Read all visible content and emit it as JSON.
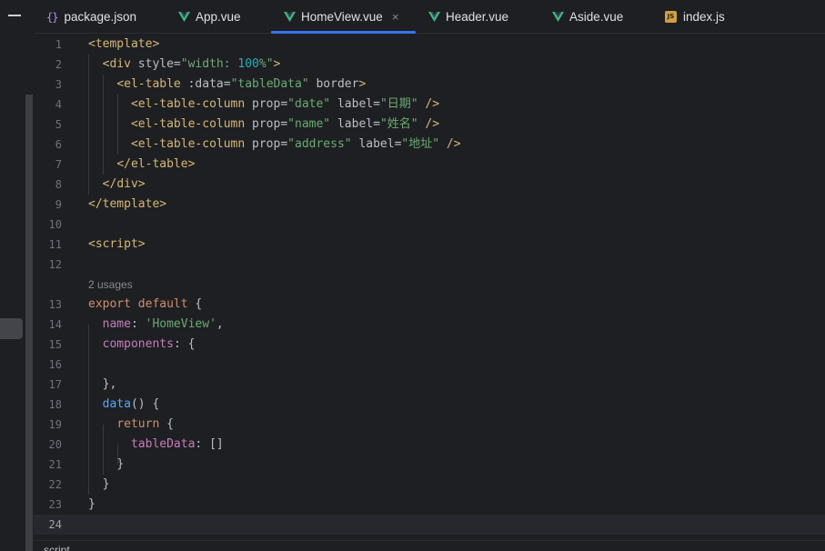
{
  "tabs": [
    {
      "label": "package.json",
      "icon": "json-braces-icon",
      "active": false
    },
    {
      "label": "App.vue",
      "icon": "vue-icon",
      "active": false
    },
    {
      "label": "HomeView.vue",
      "icon": "vue-icon",
      "active": true
    },
    {
      "label": "Header.vue",
      "icon": "vue-icon",
      "active": false
    },
    {
      "label": "Aside.vue",
      "icon": "vue-icon",
      "active": false
    },
    {
      "label": "index.js",
      "icon": "js-icon",
      "active": false
    }
  ],
  "tab_close_glyph": "×",
  "js_badge": "JS",
  "json_glyph": "{}",
  "usages_hint": "2 usages",
  "current_line": 24,
  "line_numbers": [
    "1",
    "2",
    "3",
    "4",
    "5",
    "6",
    "7",
    "8",
    "9",
    "10",
    "11",
    "12",
    "13",
    "14",
    "15",
    "16",
    "17",
    "18",
    "19",
    "20",
    "21",
    "22",
    "23",
    "24"
  ],
  "breadcrumb": "script",
  "colors": {
    "accent": "#3574f0",
    "tag": "#d5b778",
    "string": "#6aab73",
    "keyword": "#cf8e6d",
    "property": "#c77dbb",
    "function": "#56a8f5",
    "number": "#2aacb8",
    "vue_green": "#41b883"
  },
  "code": {
    "l1": {
      "open": "<",
      "tag": "template",
      "close": ">"
    },
    "l2": {
      "open": "<",
      "tag": "div",
      "attr": " style=",
      "val_a": "\"width: ",
      "num": "100",
      "val_b": "%\"",
      "close": ">"
    },
    "l3": {
      "open": "<",
      "tag": "el-table",
      "attr1": " :data=",
      "val1": "\"tableData\"",
      "attr2": " border",
      "close": ">"
    },
    "l4": {
      "open": "<",
      "tag": "el-table-column",
      "attr1": " prop=",
      "val1": "\"date\"",
      "attr2": " label=",
      "val2": "\"日期\"",
      "close": " />"
    },
    "l5": {
      "open": "<",
      "tag": "el-table-column",
      "attr1": " prop=",
      "val1": "\"name\"",
      "attr2": " label=",
      "val2": "\"姓名\"",
      "close": " />"
    },
    "l6": {
      "open": "<",
      "tag": "el-table-column",
      "attr1": " prop=",
      "val1": "\"address\"",
      "attr2": " label=",
      "val2": "\"地址\"",
      "close": " />"
    },
    "l7": {
      "open": "</",
      "tag": "el-table",
      "close": ">"
    },
    "l8": {
      "open": "</",
      "tag": "div",
      "close": ">"
    },
    "l9": {
      "open": "</",
      "tag": "template",
      "close": ">"
    },
    "l11": {
      "open": "<",
      "tag": "script",
      "close": ">"
    },
    "l13": {
      "kw1": "export",
      "kw2": " default",
      "rest": " {"
    },
    "l14": {
      "prop": "name",
      "colon": ": ",
      "str": "'HomeView'",
      "rest": ","
    },
    "l15": {
      "prop": "components",
      "rest": ": {"
    },
    "l17": {
      "text": "},"
    },
    "l18": {
      "fn": "data",
      "rest": "() {"
    },
    "l19": {
      "kw": "return",
      "rest": " {"
    },
    "l20": {
      "prop": "tableData",
      "rest": ": []"
    },
    "l21": {
      "text": "}"
    },
    "l22": {
      "text": "}"
    },
    "l23": {
      "text": "}"
    }
  }
}
